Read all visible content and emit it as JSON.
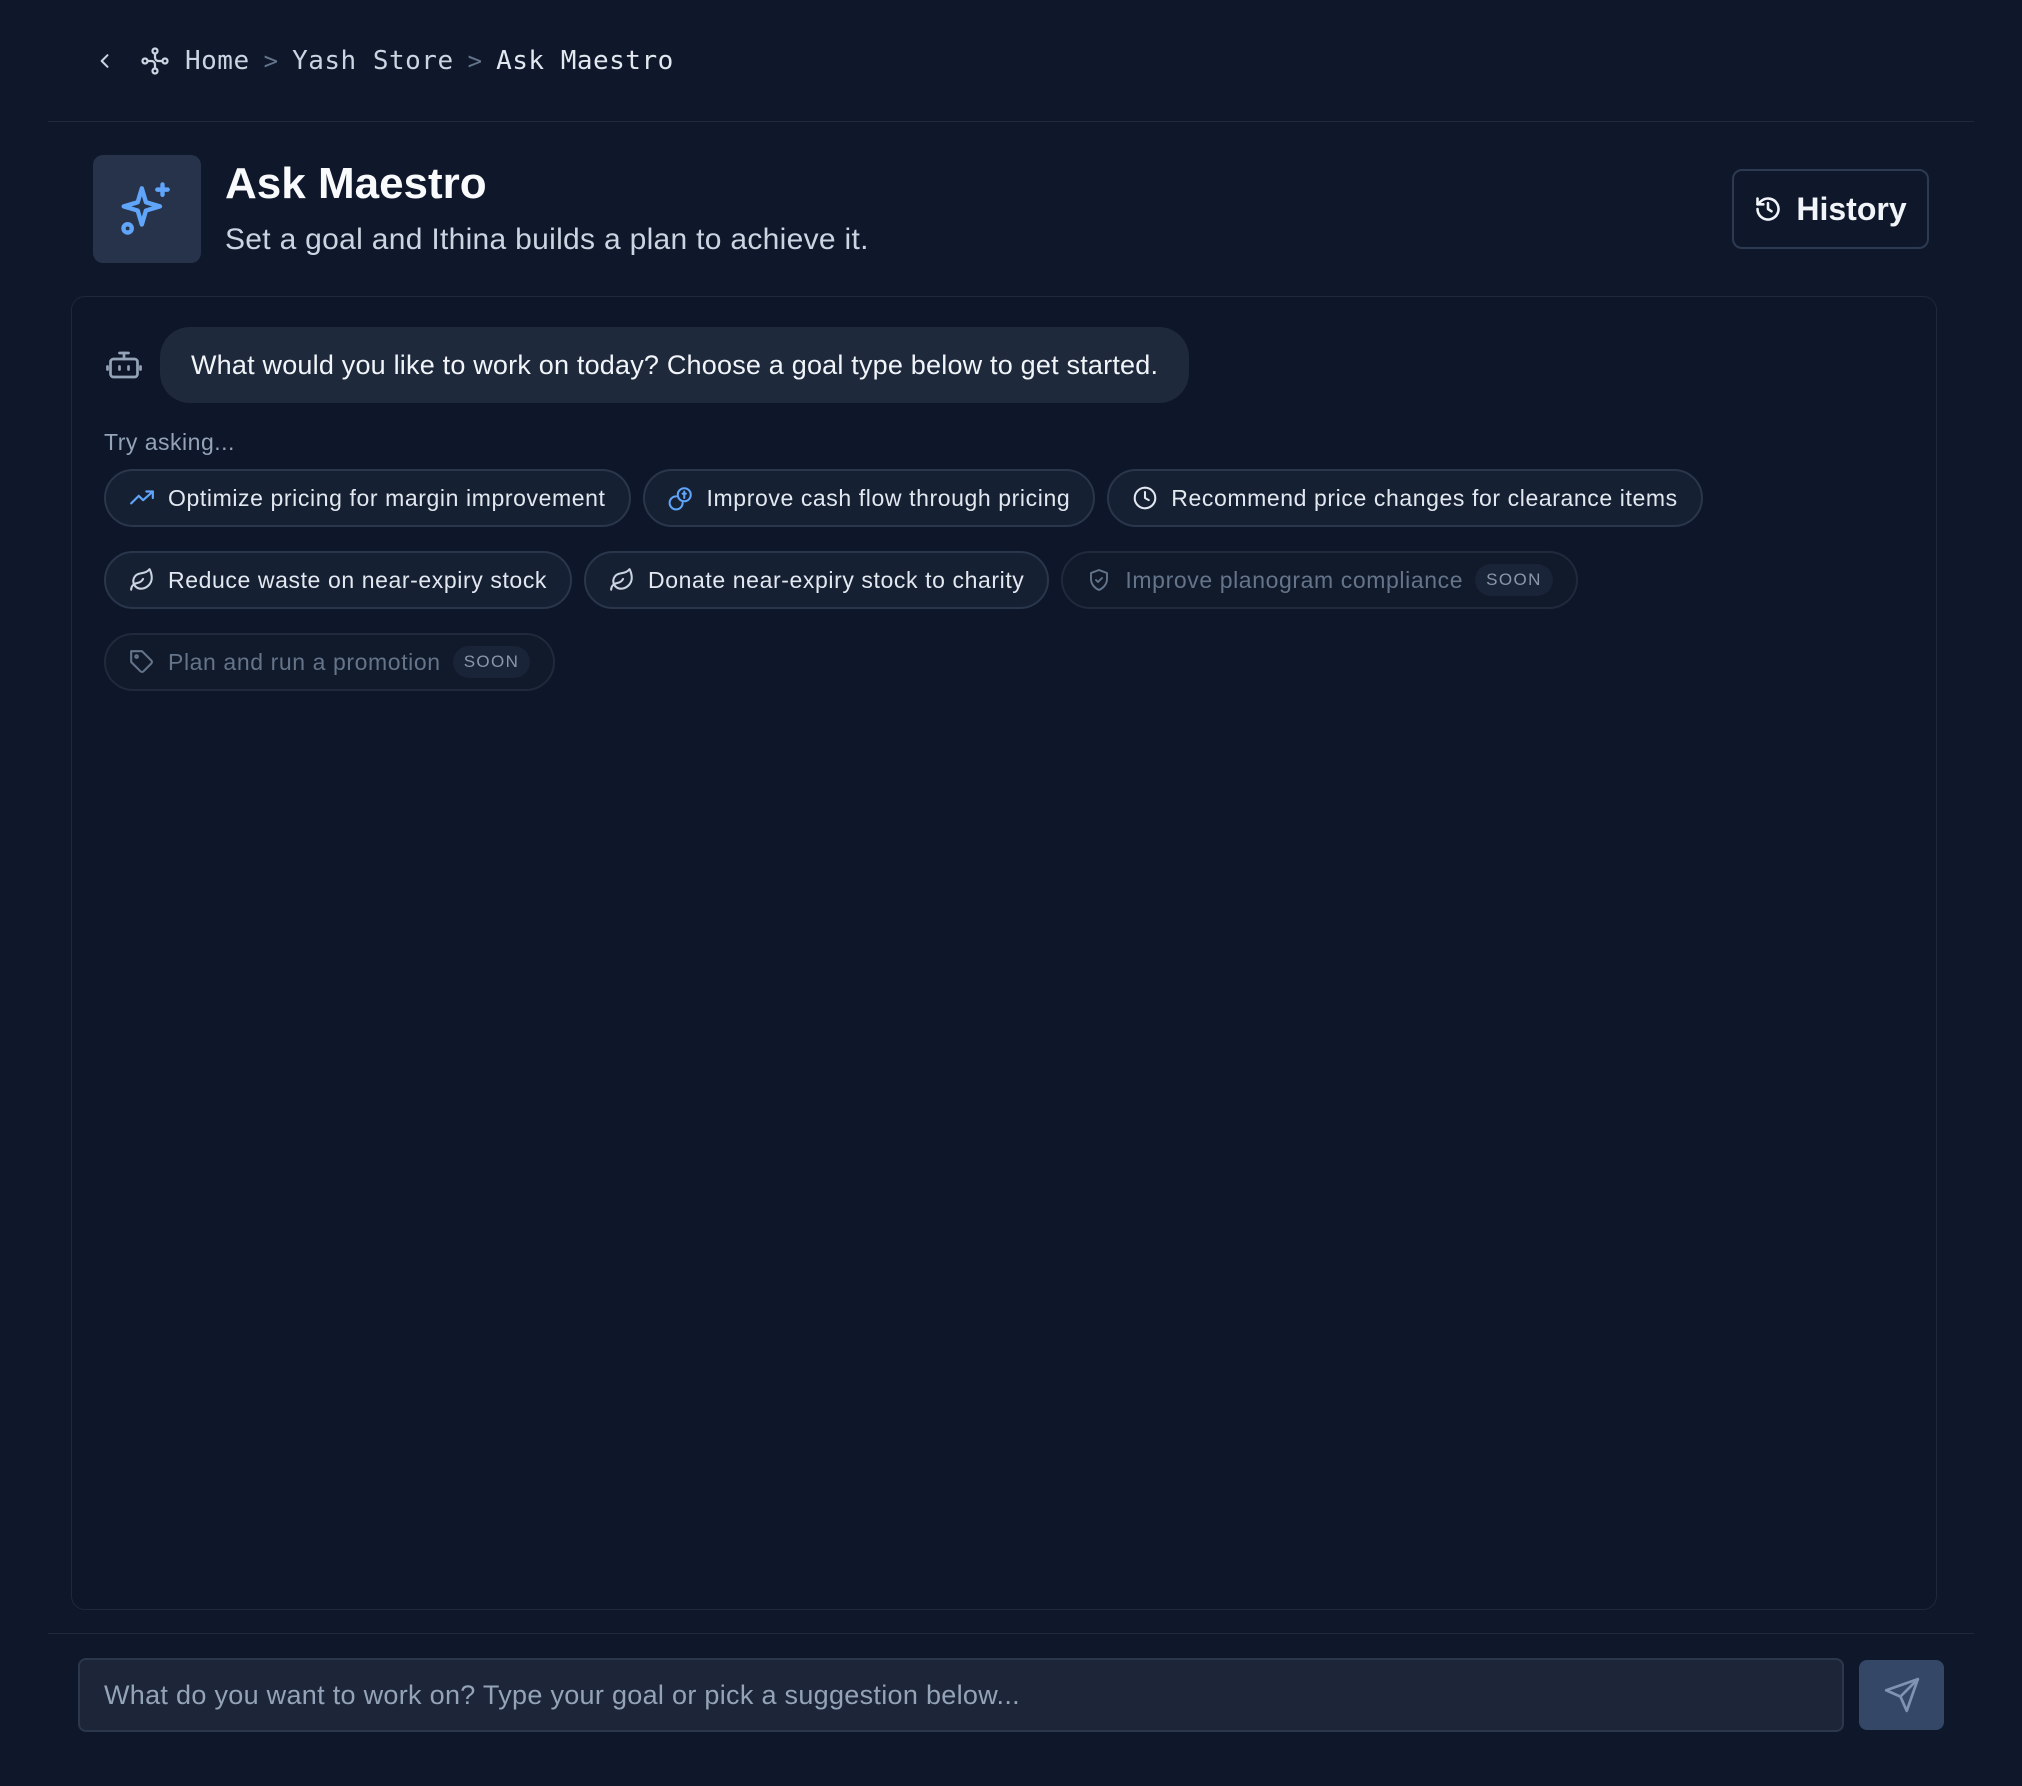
{
  "breadcrumb": {
    "items": [
      "Home",
      "Yash Store",
      "Ask Maestro"
    ],
    "separator": ">"
  },
  "header": {
    "title": "Ask Maestro",
    "subtitle": "Set a goal and Ithina builds a plan to achieve it.",
    "history_label": "History"
  },
  "chat": {
    "bot_message": "What would you like to work on today? Choose a goal type below to get started.",
    "try_label": "Try asking...",
    "suggestions": [
      {
        "label": "Optimize pricing for margin improvement",
        "icon": "trending-up-icon",
        "enabled": true
      },
      {
        "label": "Improve cash flow through pricing",
        "icon": "coins-icon",
        "enabled": true
      },
      {
        "label": "Recommend price changes for clearance items",
        "icon": "clock-icon",
        "enabled": true
      },
      {
        "label": "Reduce waste on near-expiry stock",
        "icon": "leaf-icon",
        "enabled": true
      },
      {
        "label": "Donate near-expiry stock to charity",
        "icon": "leaf-icon",
        "enabled": true
      },
      {
        "label": "Improve planogram compliance",
        "icon": "shield-check-icon",
        "enabled": false,
        "badge": "SOON"
      },
      {
        "label": "Plan and run a promotion",
        "icon": "tag-icon",
        "enabled": false,
        "badge": "SOON"
      }
    ]
  },
  "composer": {
    "placeholder": "What do you want to work on? Type your goal or pick a suggestion below..."
  },
  "colors": {
    "background": "#0f172a",
    "accent": "#60a5fa",
    "bubble": "#1e293b",
    "send_button": "#344766"
  }
}
